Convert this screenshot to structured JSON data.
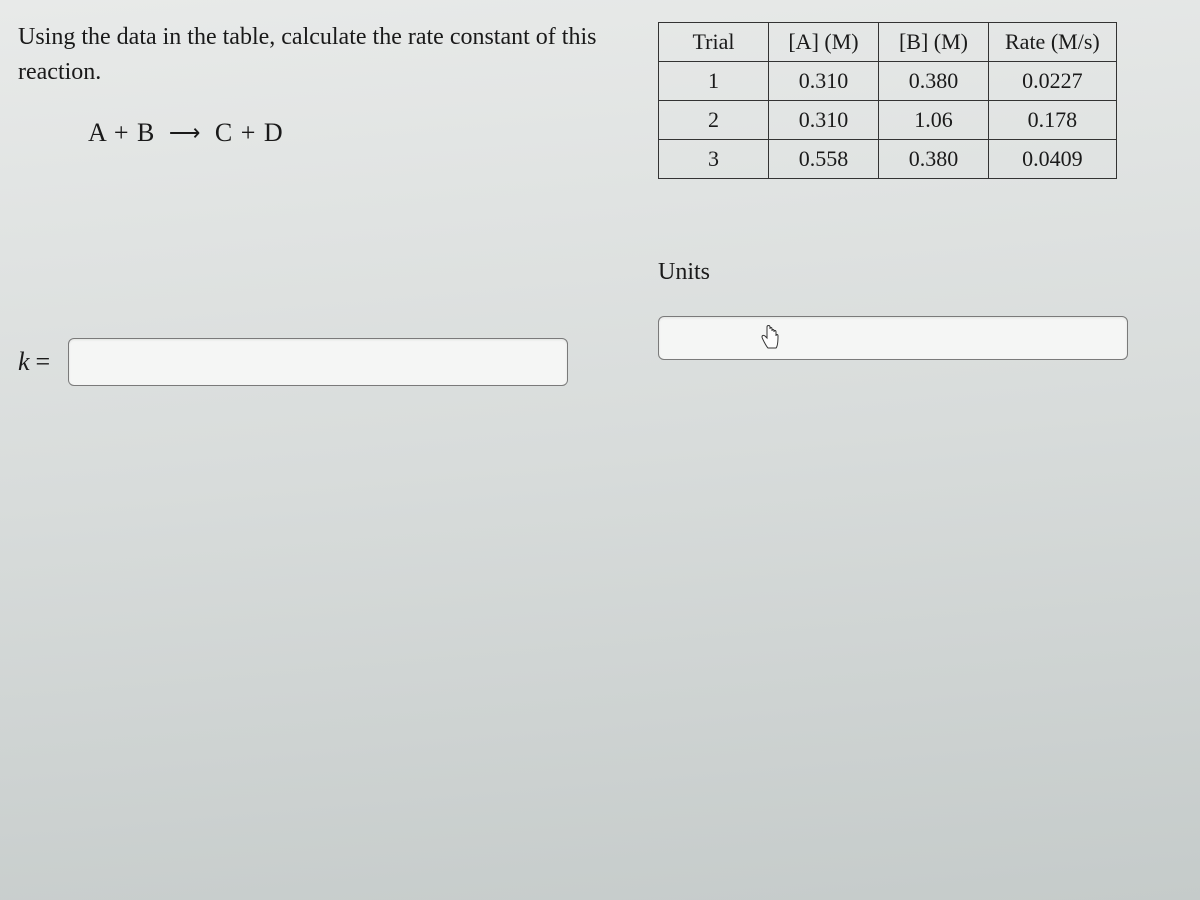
{
  "prompt": {
    "text": "Using the data in the table, calculate the rate constant of this reaction.",
    "equation_lhs": "A + B",
    "equation_rhs": "C + D"
  },
  "table": {
    "headers": [
      "Trial",
      "[A] (M)",
      "[B] (M)",
      "Rate (M/s)"
    ],
    "rows": [
      [
        "1",
        "0.310",
        "0.380",
        "0.0227"
      ],
      [
        "2",
        "0.310",
        "1.06",
        "0.178"
      ],
      [
        "3",
        "0.558",
        "0.380",
        "0.0409"
      ]
    ]
  },
  "answer": {
    "k_label": "k",
    "equals": "=",
    "value": ""
  },
  "units": {
    "label": "Units",
    "value": ""
  }
}
